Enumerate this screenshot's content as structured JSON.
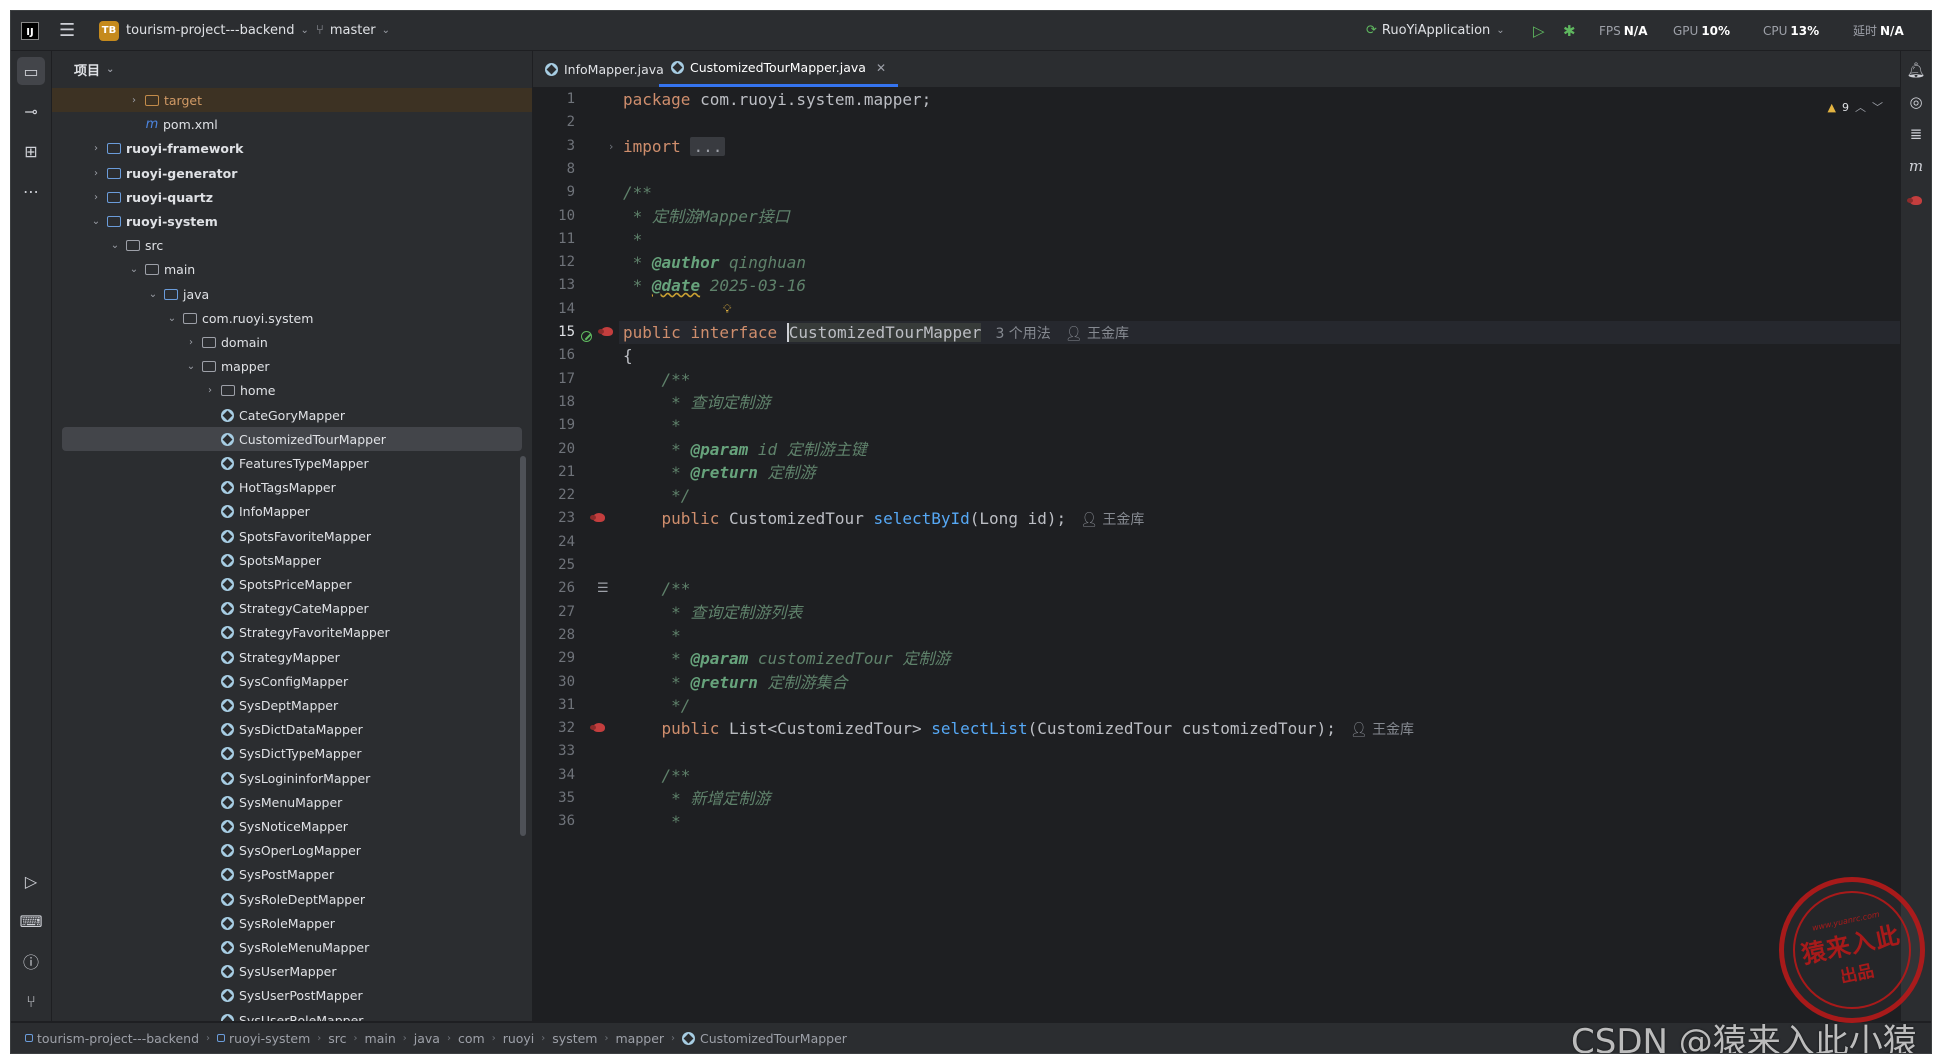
{
  "titlebar": {
    "project_badge": "TB",
    "project_name": "tourism-project---backend",
    "branch": "master",
    "run_config": "RuoYiApplication",
    "stats": [
      {
        "label": "FPS",
        "value": "N/A"
      },
      {
        "label": "GPU",
        "value": "10%"
      },
      {
        "label": "CPU",
        "value": "13%"
      },
      {
        "label": "延时",
        "value": "N/A"
      }
    ]
  },
  "project_panel": {
    "title": "项目",
    "tree": [
      {
        "label": "target",
        "depth": 3,
        "arrow": "right",
        "icon": "folder-orange",
        "style": "orange",
        "excluded": true
      },
      {
        "label": "pom.xml",
        "depth": 3,
        "arrow": "",
        "icon": "maven"
      },
      {
        "label": "ruoyi-framework",
        "depth": 1,
        "arrow": "right",
        "icon": "module",
        "style": "bold"
      },
      {
        "label": "ruoyi-generator",
        "depth": 1,
        "arrow": "right",
        "icon": "module",
        "style": "bold"
      },
      {
        "label": "ruoyi-quartz",
        "depth": 1,
        "arrow": "right",
        "icon": "module",
        "style": "bold"
      },
      {
        "label": "ruoyi-system",
        "depth": 1,
        "arrow": "down",
        "icon": "module",
        "style": "bold"
      },
      {
        "label": "src",
        "depth": 2,
        "arrow": "down",
        "icon": "folder"
      },
      {
        "label": "main",
        "depth": 3,
        "arrow": "down",
        "icon": "folder"
      },
      {
        "label": "java",
        "depth": 4,
        "arrow": "down",
        "icon": "folder-blue"
      },
      {
        "label": "com.ruoyi.system",
        "depth": 5,
        "arrow": "down",
        "icon": "folder"
      },
      {
        "label": "domain",
        "depth": 6,
        "arrow": "right",
        "icon": "folder"
      },
      {
        "label": "mapper",
        "depth": 6,
        "arrow": "down",
        "icon": "folder"
      },
      {
        "label": "home",
        "depth": 7,
        "arrow": "right",
        "icon": "folder"
      },
      {
        "label": "CateGoryMapper",
        "depth": 7,
        "arrow": "",
        "icon": "interface"
      },
      {
        "label": "CustomizedTourMapper",
        "depth": 7,
        "arrow": "",
        "icon": "interface",
        "selected": true
      },
      {
        "label": "FeaturesTypeMapper",
        "depth": 7,
        "arrow": "",
        "icon": "interface"
      },
      {
        "label": "HotTagsMapper",
        "depth": 7,
        "arrow": "",
        "icon": "interface"
      },
      {
        "label": "InfoMapper",
        "depth": 7,
        "arrow": "",
        "icon": "interface"
      },
      {
        "label": "SpotsFavoriteMapper",
        "depth": 7,
        "arrow": "",
        "icon": "interface"
      },
      {
        "label": "SpotsMapper",
        "depth": 7,
        "arrow": "",
        "icon": "interface"
      },
      {
        "label": "SpotsPriceMapper",
        "depth": 7,
        "arrow": "",
        "icon": "interface"
      },
      {
        "label": "StrategyCateMapper",
        "depth": 7,
        "arrow": "",
        "icon": "interface"
      },
      {
        "label": "StrategyFavoriteMapper",
        "depth": 7,
        "arrow": "",
        "icon": "interface"
      },
      {
        "label": "StrategyMapper",
        "depth": 7,
        "arrow": "",
        "icon": "interface"
      },
      {
        "label": "SysConfigMapper",
        "depth": 7,
        "arrow": "",
        "icon": "interface"
      },
      {
        "label": "SysDeptMapper",
        "depth": 7,
        "arrow": "",
        "icon": "interface"
      },
      {
        "label": "SysDictDataMapper",
        "depth": 7,
        "arrow": "",
        "icon": "interface"
      },
      {
        "label": "SysDictTypeMapper",
        "depth": 7,
        "arrow": "",
        "icon": "interface"
      },
      {
        "label": "SysLogininforMapper",
        "depth": 7,
        "arrow": "",
        "icon": "interface"
      },
      {
        "label": "SysMenuMapper",
        "depth": 7,
        "arrow": "",
        "icon": "interface"
      },
      {
        "label": "SysNoticeMapper",
        "depth": 7,
        "arrow": "",
        "icon": "interface"
      },
      {
        "label": "SysOperLogMapper",
        "depth": 7,
        "arrow": "",
        "icon": "interface"
      },
      {
        "label": "SysPostMapper",
        "depth": 7,
        "arrow": "",
        "icon": "interface"
      },
      {
        "label": "SysRoleDeptMapper",
        "depth": 7,
        "arrow": "",
        "icon": "interface"
      },
      {
        "label": "SysRoleMapper",
        "depth": 7,
        "arrow": "",
        "icon": "interface"
      },
      {
        "label": "SysRoleMenuMapper",
        "depth": 7,
        "arrow": "",
        "icon": "interface"
      },
      {
        "label": "SysUserMapper",
        "depth": 7,
        "arrow": "",
        "icon": "interface"
      },
      {
        "label": "SysUserPostMapper",
        "depth": 7,
        "arrow": "",
        "icon": "interface"
      },
      {
        "label": "SysUserRoleMapper",
        "depth": 7,
        "arrow": "",
        "icon": "interface"
      }
    ]
  },
  "editor": {
    "tabs": [
      {
        "label": "InfoMapper.java",
        "active": false
      },
      {
        "label": "CustomizedTourMapper.java",
        "active": true
      }
    ],
    "inspection_count": "9",
    "current_line": "15",
    "lines": [
      {
        "n": "1",
        "text": "package com.ruoyi.system.mapper;"
      },
      {
        "n": "2",
        "text": ""
      },
      {
        "n": "3",
        "text": "import ..."
      },
      {
        "n": "8",
        "text": ""
      },
      {
        "n": "9",
        "text": "/**"
      },
      {
        "n": "10",
        "text": " * 定制游Mapper接口"
      },
      {
        "n": "11",
        "text": " *"
      },
      {
        "n": "12",
        "text": " * @author qinghuan"
      },
      {
        "n": "13",
        "text": " * @date 2025-03-16"
      },
      {
        "n": "14",
        "text": ""
      },
      {
        "n": "15",
        "text": "public interface CustomizedTourMapper"
      },
      {
        "n": "16",
        "text": "{"
      },
      {
        "n": "17",
        "text": "    /**"
      },
      {
        "n": "18",
        "text": "     * 查询定制游"
      },
      {
        "n": "19",
        "text": "     *"
      },
      {
        "n": "20",
        "text": "     * @param id 定制游主键"
      },
      {
        "n": "21",
        "text": "     * @return 定制游"
      },
      {
        "n": "22",
        "text": "     */"
      },
      {
        "n": "23",
        "text": "    public CustomizedTour selectById(Long id);"
      },
      {
        "n": "24",
        "text": ""
      },
      {
        "n": "25",
        "text": ""
      },
      {
        "n": "26",
        "text": "    /**"
      },
      {
        "n": "27",
        "text": "     * 查询定制游列表"
      },
      {
        "n": "28",
        "text": "     *"
      },
      {
        "n": "29",
        "text": "     * @param customizedTour 定制游"
      },
      {
        "n": "30",
        "text": "     * @return 定制游集合"
      },
      {
        "n": "31",
        "text": "     */"
      },
      {
        "n": "32",
        "text": "    public List<CustomizedTour> selectList(CustomizedTour customizedTour);"
      },
      {
        "n": "33",
        "text": ""
      },
      {
        "n": "34",
        "text": "    /**"
      },
      {
        "n": "35",
        "text": "     * 新增定制游"
      },
      {
        "n": "36",
        "text": "     *"
      }
    ],
    "hints": {
      "usages": "3 个用法",
      "author": "王金库"
    }
  },
  "statusbar": {
    "breadcrumbs": [
      "tourism-project---backend",
      "ruoyi-system",
      "src",
      "main",
      "java",
      "com",
      "ruoyi",
      "system",
      "mapper",
      "CustomizedTourMapper"
    ]
  },
  "watermark": {
    "stamp_url": "www.yuanrc.com",
    "stamp_main": "猿来入此",
    "stamp_sub": "出品",
    "csdn": "CSDN @猿来入此小猿"
  }
}
